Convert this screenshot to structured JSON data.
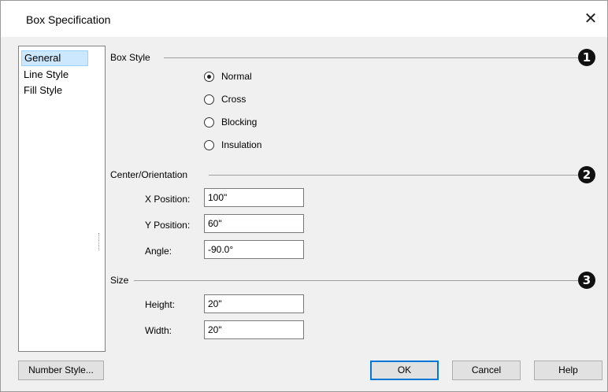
{
  "window": {
    "title": "Box Specification",
    "close_glyph": "✕"
  },
  "nav": {
    "items": [
      {
        "label": "General"
      },
      {
        "label": "Line Style"
      },
      {
        "label": "Fill Style"
      }
    ],
    "selected": "General"
  },
  "box_style": {
    "label": "Box Style",
    "badge": "1",
    "options": [
      {
        "label": "Normal",
        "checked": true
      },
      {
        "label": "Cross",
        "checked": false
      },
      {
        "label": "Blocking",
        "checked": false
      },
      {
        "label": "Insulation",
        "checked": false
      }
    ]
  },
  "center": {
    "label": "Center/Orientation",
    "badge": "2",
    "x_label": "X Position:",
    "x_value": "100\"",
    "y_label": "Y Position:",
    "y_value": "60\"",
    "angle_label": "Angle:",
    "angle_value": "-90.0°"
  },
  "size": {
    "label": "Size",
    "badge": "3",
    "height_label": "Height:",
    "height_value": "20\"",
    "width_label": "Width:",
    "width_value": "20\""
  },
  "buttons": {
    "number_style": "Number Style...",
    "ok": "OK",
    "cancel": "Cancel",
    "help": "Help"
  }
}
